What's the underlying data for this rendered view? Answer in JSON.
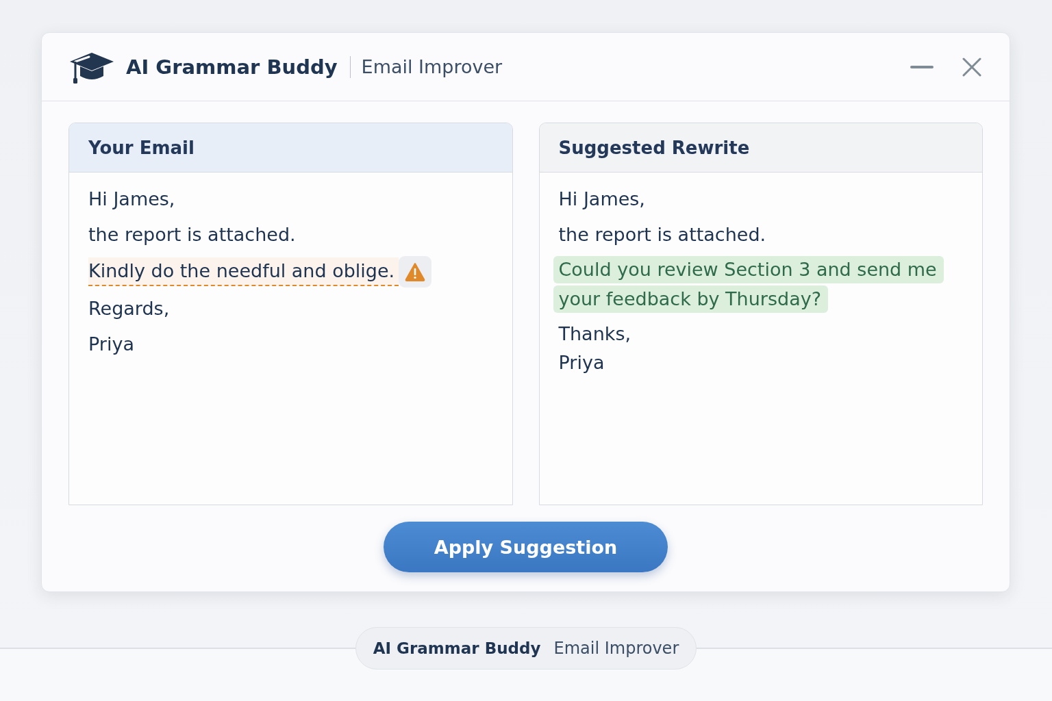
{
  "window": {
    "app_name": "AI Grammar Buddy",
    "subtitle": "Email Improver"
  },
  "panels": [
    {
      "title": "Your Email",
      "kind": "original",
      "paragraphs": [
        {
          "kind": "plain",
          "lines": [
            "Hi James,"
          ]
        },
        {
          "kind": "plain",
          "lines": [
            "the report is attached."
          ]
        },
        {
          "kind": "flagged",
          "lines": [
            "Kindly do the needful and oblige."
          ]
        },
        {
          "kind": "plain",
          "lines": [
            "Regards,"
          ]
        },
        {
          "kind": "plain",
          "lines": [
            "Priya"
          ]
        }
      ]
    },
    {
      "title": "Suggested Rewrite",
      "kind": "rewrite",
      "paragraphs": [
        {
          "kind": "plain",
          "lines": [
            "Hi James,"
          ]
        },
        {
          "kind": "plain",
          "lines": [
            "the report is attached."
          ]
        },
        {
          "kind": "suggested",
          "lines": [
            "Could you review Section 3 and send me",
            "your feedback by Thursday?"
          ]
        },
        {
          "kind": "plain",
          "lines": [
            "Thanks,",
            "Priya"
          ]
        }
      ]
    }
  ],
  "apply_button": {
    "label": "Apply Suggestion"
  },
  "footer": {
    "app_name": "AI Grammar Buddy",
    "subtitle": "Email Improver"
  }
}
